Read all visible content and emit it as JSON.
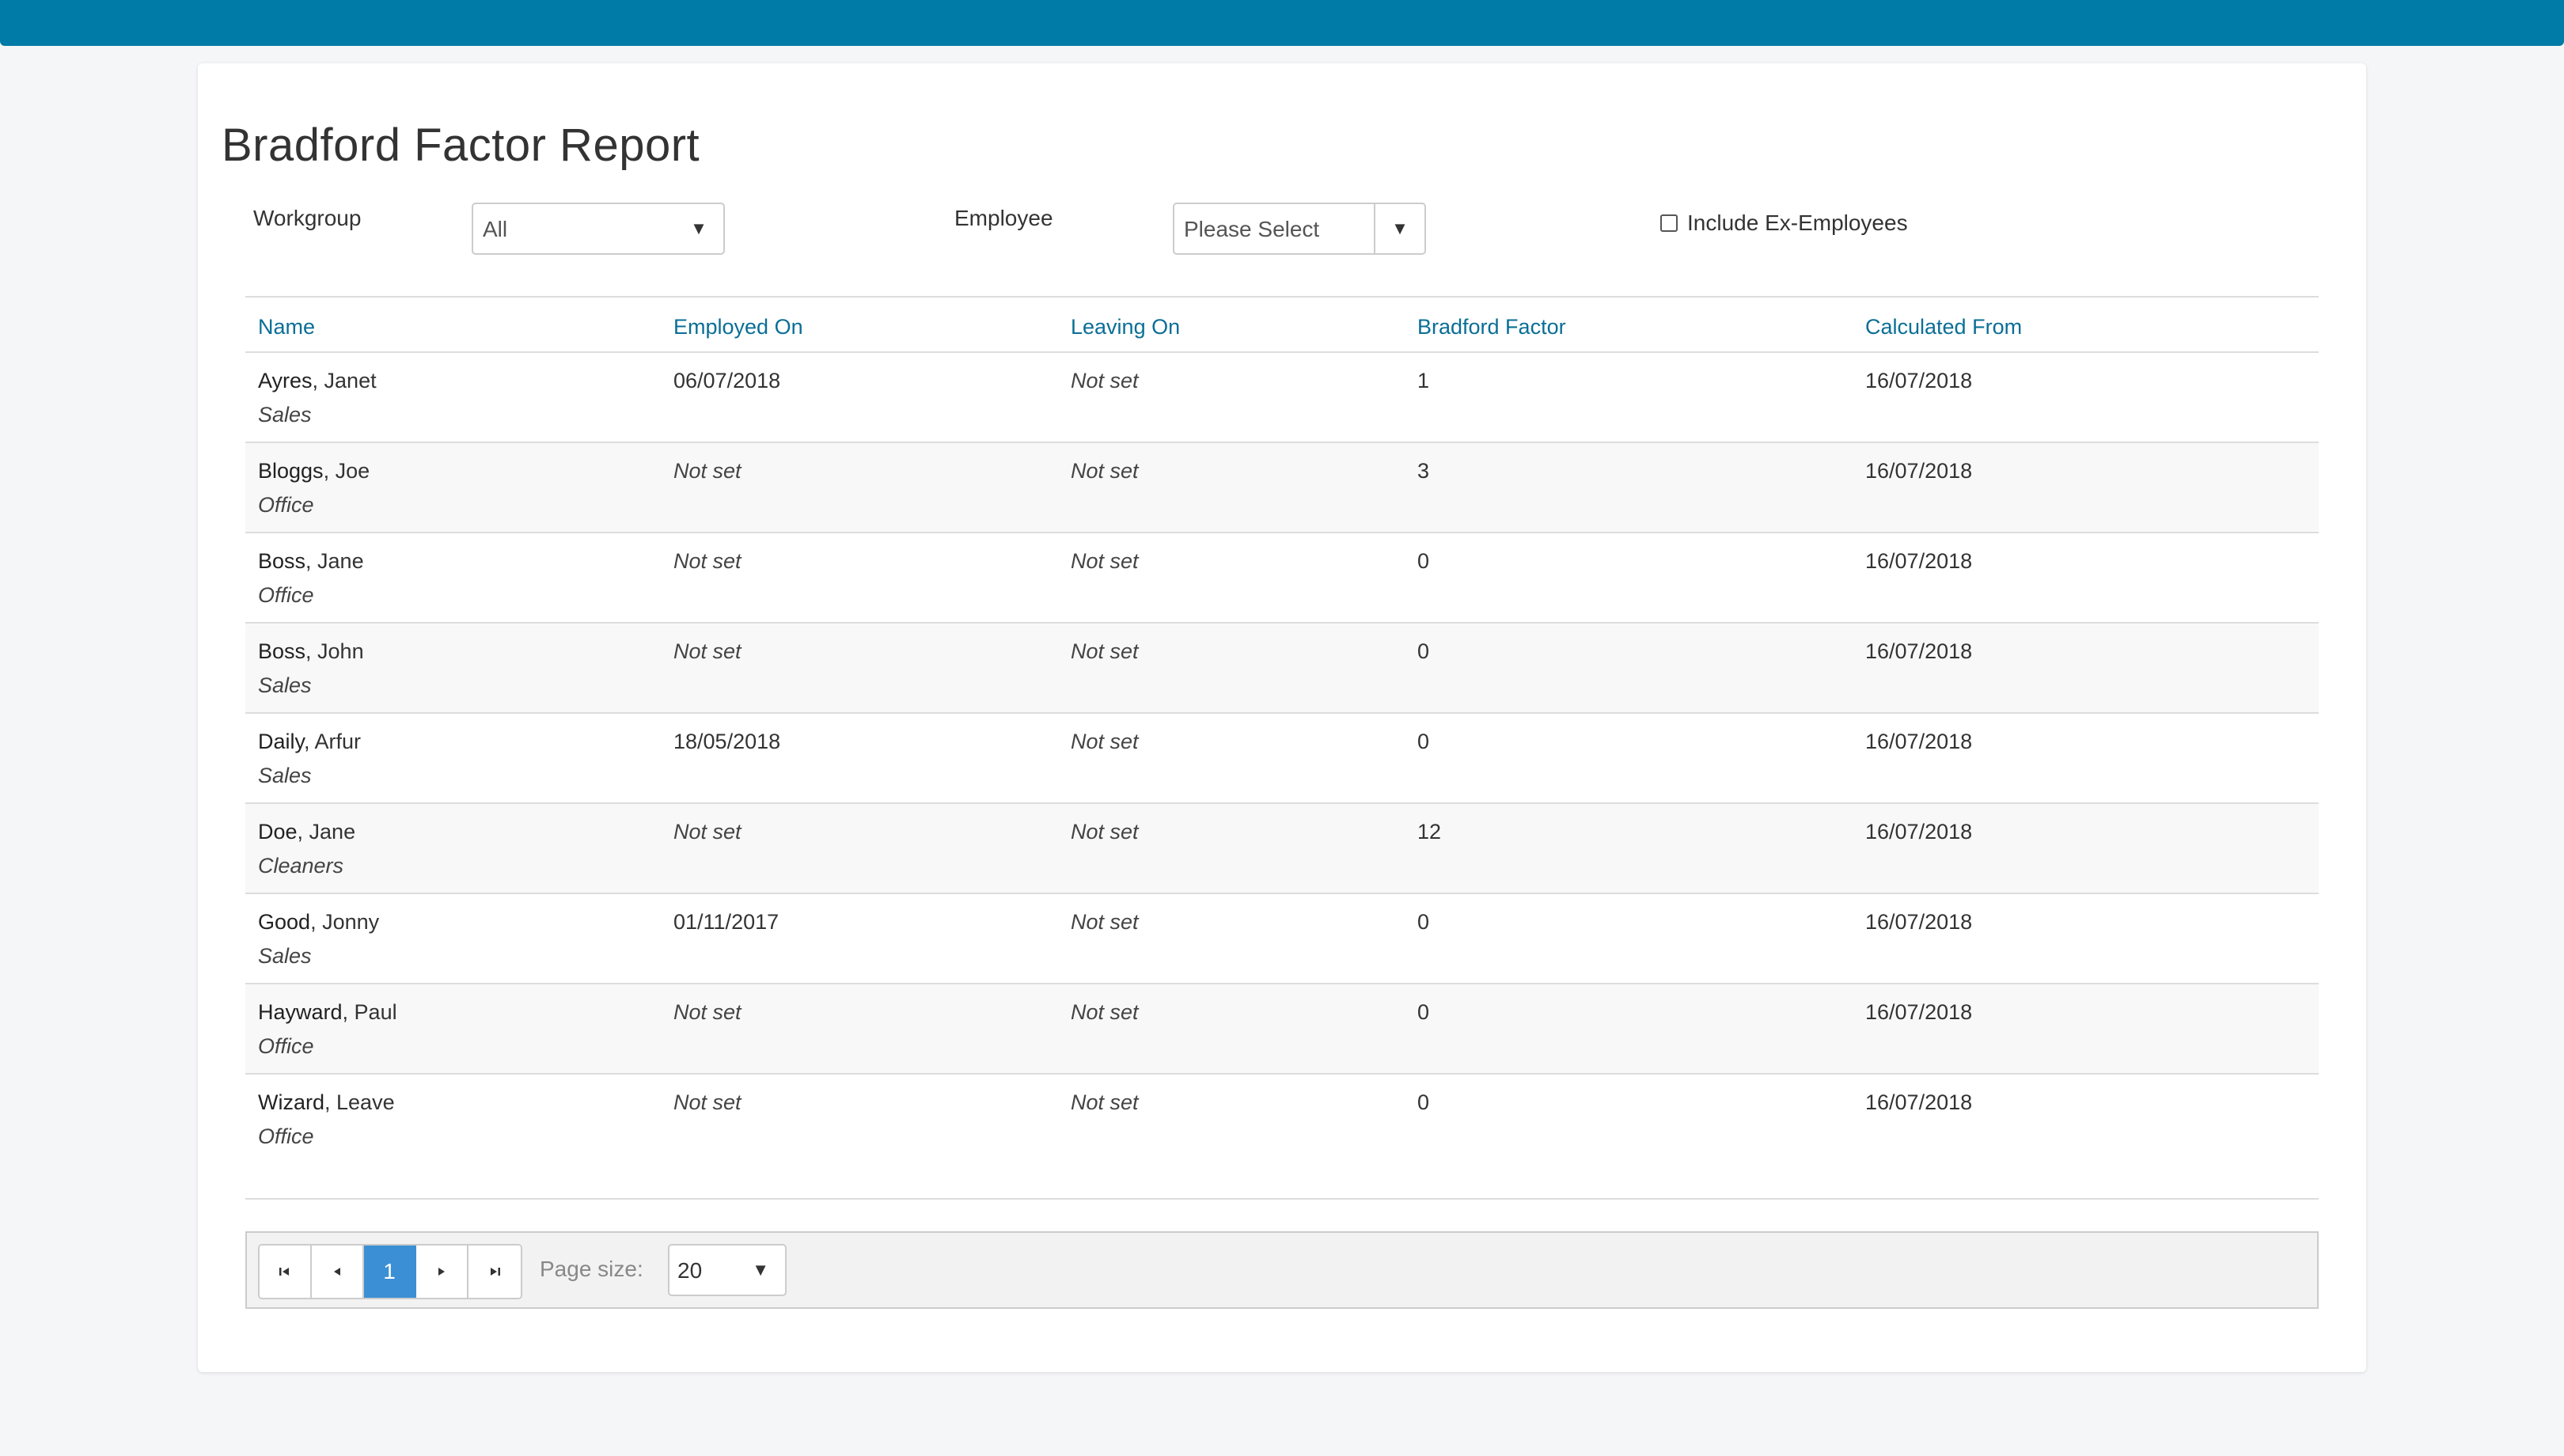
{
  "page": {
    "title": "Bradford Factor Report",
    "accent_color": "#007aa6",
    "link_color": "#0a6e96",
    "active_page_color": "#3b8fd4"
  },
  "filters": {
    "workgroup_label": "Workgroup",
    "workgroup_value": "All",
    "employee_label": "Employee",
    "employee_value": "Please Select",
    "include_ex_label": "Include Ex-Employees",
    "include_ex_checked": false,
    "dropdown_icon": "caret-down-icon"
  },
  "table": {
    "columns": [
      "Name",
      "Employed On",
      "Leaving On",
      "Bradford Factor",
      "Calculated From"
    ],
    "rows": [
      {
        "surname": "Ayres",
        "forename": ", Janet",
        "group": "Sales",
        "employed": "06/07/2018",
        "leaving": "Not set",
        "factor": "1",
        "from": "16/07/2018"
      },
      {
        "surname": "Bloggs",
        "forename": ", Joe",
        "group": "Office",
        "employed": "Not set",
        "leaving": "Not set",
        "factor": "3",
        "from": "16/07/2018"
      },
      {
        "surname": "Boss",
        "forename": ", Jane",
        "group": "Office",
        "employed": "Not set",
        "leaving": "Not set",
        "factor": "0",
        "from": "16/07/2018"
      },
      {
        "surname": "Boss",
        "forename": ", John",
        "group": "Sales",
        "employed": "Not set",
        "leaving": "Not set",
        "factor": "0",
        "from": "16/07/2018"
      },
      {
        "surname": "Daily",
        "forename": ", Arfur",
        "group": "Sales",
        "employed": "18/05/2018",
        "leaving": "Not set",
        "factor": "0",
        "from": "16/07/2018"
      },
      {
        "surname": "Doe",
        "forename": ", Jane",
        "group": "Cleaners",
        "employed": "Not set",
        "leaving": "Not set",
        "factor": "12",
        "from": "16/07/2018"
      },
      {
        "surname": "Good",
        "forename": ", Jonny",
        "group": "Sales",
        "employed": "01/11/2017",
        "leaving": "Not set",
        "factor": "0",
        "from": "16/07/2018"
      },
      {
        "surname": "Hayward",
        "forename": ", Paul",
        "group": "Office",
        "employed": "Not set",
        "leaving": "Not set",
        "factor": "0",
        "from": "16/07/2018"
      },
      {
        "surname": "Wizard",
        "forename": ", Leave",
        "group": "Office",
        "employed": "Not set",
        "leaving": "Not set",
        "factor": "0",
        "from": "16/07/2018"
      }
    ]
  },
  "pager": {
    "first_icon": "first-page-icon",
    "prev_icon": "prev-page-icon",
    "current_page": "1",
    "next_icon": "next-page-icon",
    "last_icon": "last-page-icon",
    "page_size_label": "Page size:",
    "page_size_value": "20"
  }
}
